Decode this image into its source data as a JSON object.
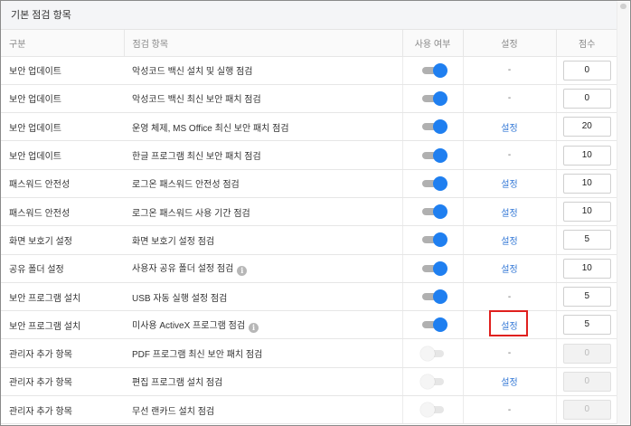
{
  "section": {
    "title": "기본 점검 항목"
  },
  "columns": {
    "category": "구분",
    "item": "점검 항목",
    "use": "사용 여부",
    "setting": "설정",
    "score": "점수"
  },
  "colors": {
    "accent": "#1f7ff0",
    "link": "#3579d6",
    "highlight": "#e0201e"
  },
  "rows": [
    {
      "category": "보안 업데이트",
      "item": "악성코드 백신 설치 및 실행 점검",
      "info": false,
      "enabled": true,
      "setting": "-",
      "setting_link": false,
      "score": "0",
      "score_disabled": false
    },
    {
      "category": "보안 업데이트",
      "item": "악성코드 백신 최신 보안 패치 점검",
      "info": false,
      "enabled": true,
      "setting": "-",
      "setting_link": false,
      "score": "0",
      "score_disabled": false
    },
    {
      "category": "보안 업데이트",
      "item": "운영 체제, MS Office 최신 보안 패치 점검",
      "info": false,
      "enabled": true,
      "setting": "설정",
      "setting_link": true,
      "score": "20",
      "score_disabled": false
    },
    {
      "category": "보안 업데이트",
      "item": "한글 프로그램 최신 보안 패치 점검",
      "info": false,
      "enabled": true,
      "setting": "-",
      "setting_link": false,
      "score": "10",
      "score_disabled": false
    },
    {
      "category": "패스워드 안전성",
      "item": "로그온 패스워드 안전성 점검",
      "info": false,
      "enabled": true,
      "setting": "설정",
      "setting_link": true,
      "score": "10",
      "score_disabled": false
    },
    {
      "category": "패스워드 안전성",
      "item": "로그온 패스워드 사용 기간 점검",
      "info": false,
      "enabled": true,
      "setting": "설정",
      "setting_link": true,
      "score": "10",
      "score_disabled": false
    },
    {
      "category": "화면 보호기 설정",
      "item": "화면 보호기 설정 점검",
      "info": false,
      "enabled": true,
      "setting": "설정",
      "setting_link": true,
      "score": "5",
      "score_disabled": false
    },
    {
      "category": "공유 폴더 설정",
      "item": "사용자 공유 폴더 설정 점검",
      "info": true,
      "enabled": true,
      "setting": "설정",
      "setting_link": true,
      "score": "10",
      "score_disabled": false
    },
    {
      "category": "보안 프로그램 설치",
      "item": "USB 자동 실행 설정 점검",
      "info": false,
      "enabled": true,
      "setting": "-",
      "setting_link": false,
      "score": "5",
      "score_disabled": false
    },
    {
      "category": "보안 프로그램 설치",
      "item": "미사용 ActiveX 프로그램 점검",
      "info": true,
      "enabled": true,
      "setting": "설정",
      "setting_link": true,
      "score": "5",
      "score_disabled": false
    },
    {
      "category": "관리자 추가 항목",
      "item": "PDF 프로그램 최신 보안 패치 점검",
      "info": false,
      "enabled": false,
      "setting": "-",
      "setting_link": false,
      "score": "0",
      "score_disabled": true
    },
    {
      "category": "관리자 추가 항목",
      "item": "편집 프로그램 설치 점검",
      "info": false,
      "enabled": false,
      "setting": "설정",
      "setting_link": true,
      "score": "0",
      "score_disabled": true
    },
    {
      "category": "관리자 추가 항목",
      "item": "무선 랜카드 설치 점검",
      "info": false,
      "enabled": false,
      "setting": "-",
      "setting_link": false,
      "score": "0",
      "score_disabled": true
    }
  ]
}
